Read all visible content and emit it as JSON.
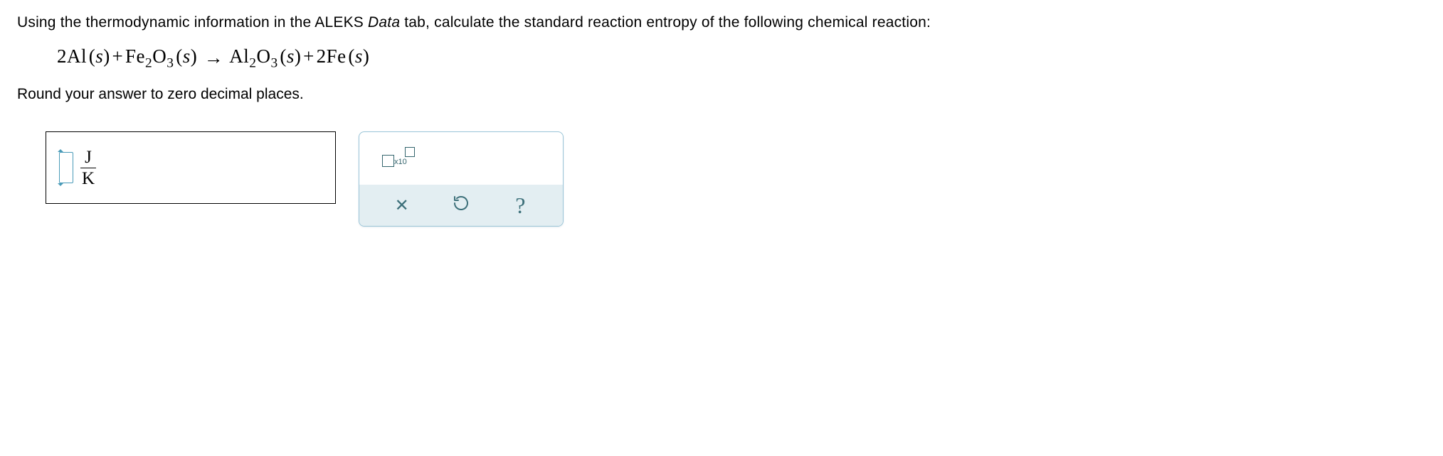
{
  "question": {
    "intro_before_italic": "Using the thermodynamic information in the ALEKS ",
    "italic_word": "Data",
    "intro_after_italic": " tab, calculate the standard reaction entropy of the following chemical reaction:",
    "round_instruction": "Round your answer to zero decimal places."
  },
  "equation": {
    "parts": [
      {
        "text": "2Al",
        "sub": "",
        "paren": "(s)"
      },
      {
        "op": " + "
      },
      {
        "text": "Fe",
        "sub": "2",
        "text2": "O",
        "sub2": "3",
        "paren": "(s)"
      },
      {
        "arrow": "→"
      },
      {
        "text": "Al",
        "sub": "2",
        "text2": "O",
        "sub2": "3",
        "paren": "(s)"
      },
      {
        "op": " + "
      },
      {
        "text": "2Fe",
        "sub": "",
        "paren": "(s)"
      }
    ],
    "raw": "2Al (s) + Fe2O3 (s) → Al2O3 (s) + 2Fe (s)"
  },
  "answer": {
    "value": "",
    "unit_numerator": "J",
    "unit_denominator": "K"
  },
  "tools": {
    "sci_label": "x10",
    "clear_label": "Clear",
    "reset_label": "Reset",
    "help_label": "Help",
    "help_symbol": "?"
  }
}
